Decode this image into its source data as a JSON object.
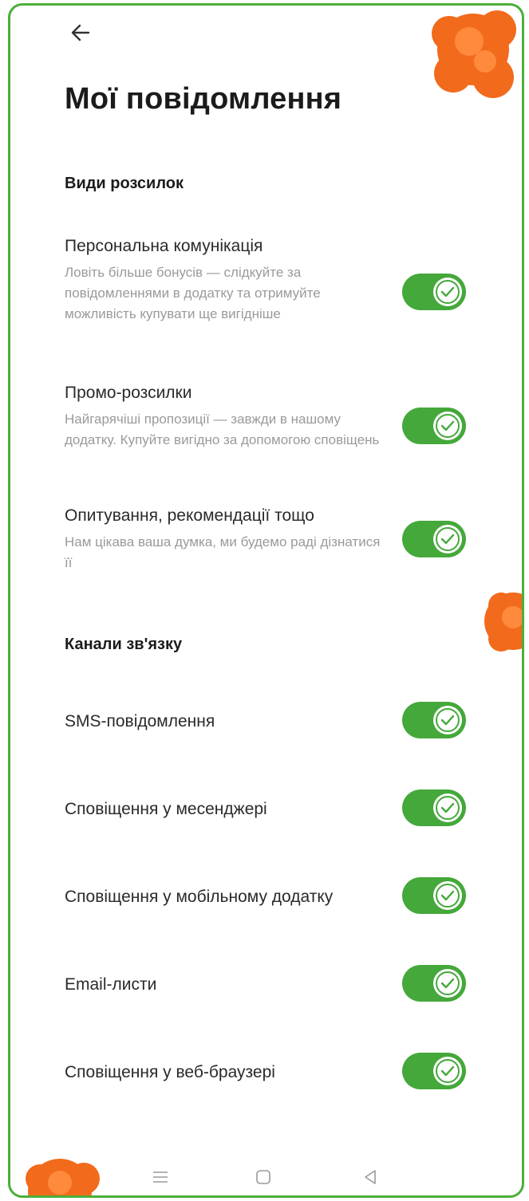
{
  "header": {
    "back_icon": "arrow-left-icon",
    "title": "Мої повідомлення"
  },
  "sections": {
    "types": {
      "title": "Види розсилок",
      "items": [
        {
          "title": "Персональна комунікація",
          "description": "Ловіть більше бонусів — слідкуйте за повідомленнями в додатку та отримуйте можливість купувати ще вигідніше",
          "enabled": true
        },
        {
          "title": "Промо-розсилки",
          "description": "Найгарячіші пропозиції — завжди в нашому додатку. Купуйте вигідно за допомогою сповіщень",
          "enabled": true
        },
        {
          "title": "Опитування, рекомендації тощо",
          "description": "Нам цікава ваша думка, ми будемо раді дізнатися її",
          "enabled": true
        }
      ]
    },
    "channels": {
      "title": "Канали зв'язку",
      "items": [
        {
          "label": "SMS-повідомлення",
          "enabled": true
        },
        {
          "label": "Сповіщення у месенджері",
          "enabled": true
        },
        {
          "label": "Сповіщення у мобільному додатку",
          "enabled": true
        },
        {
          "label": "Email-листи",
          "enabled": true
        },
        {
          "label": "Сповіщення у веб-браузері",
          "enabled": true
        }
      ]
    }
  },
  "navbar": {
    "menu_icon": "menu-icon",
    "home_icon": "square-home-icon",
    "back_icon": "triangle-back-icon"
  },
  "colors": {
    "accent": "#44a83a",
    "frame": "#4caf3a",
    "decoration": "#f26a1b"
  }
}
